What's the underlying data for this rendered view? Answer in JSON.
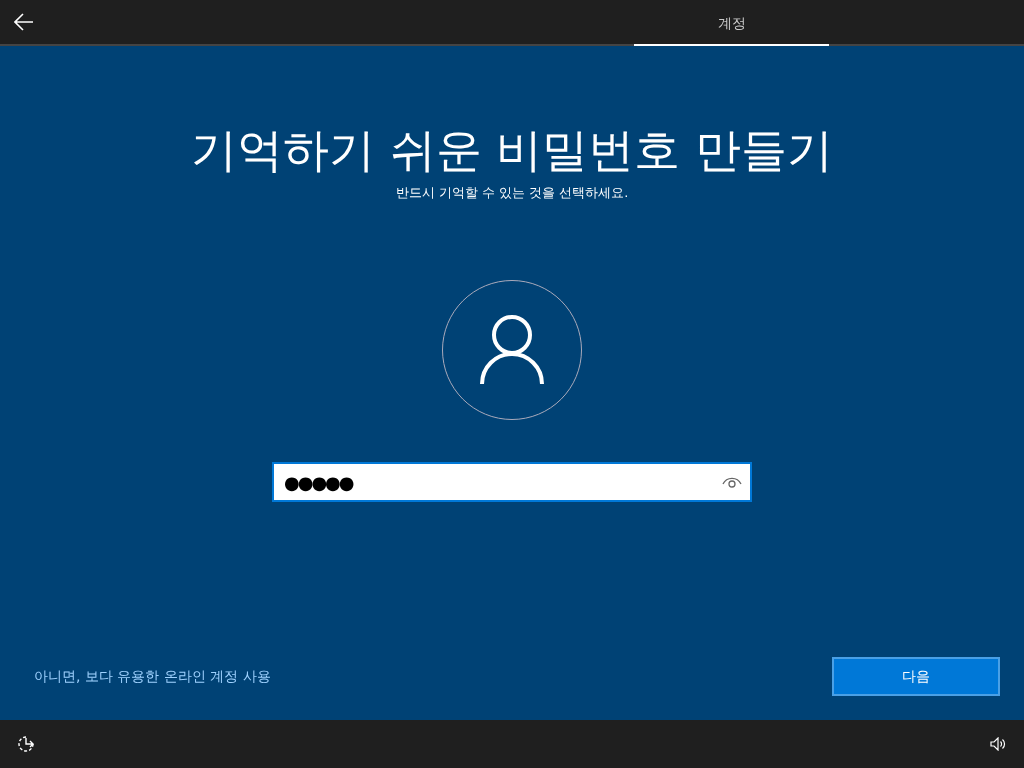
{
  "tabs": [
    {
      "label": "계정",
      "selected": true
    }
  ],
  "title": "기억하기 쉬운 비밀번호 만들기",
  "subtitle": "반드시 기억할 수 있는 것을 선택하세요.",
  "password": {
    "value": "●●●●●"
  },
  "alternate_link": "아니면, 보다 유용한 온라인 계정 사용",
  "next_button": "다음"
}
